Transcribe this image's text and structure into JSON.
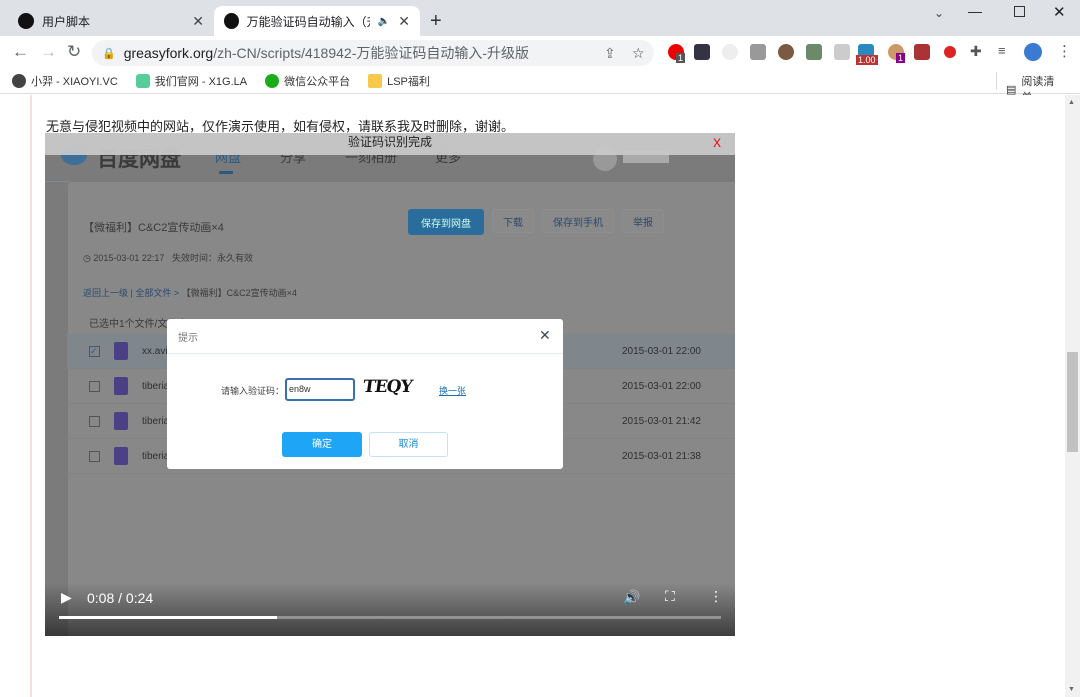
{
  "browser": {
    "tabs": [
      {
        "title": "用户脚本",
        "active": false
      },
      {
        "title": "万能验证码自动输入（升级版",
        "active": true
      }
    ],
    "url_host": "greasyfork.org",
    "url_path": "/zh-CN/scripts/418942-万能验证码自动输入-升级版",
    "bookmarks": [
      "小羿 - XIAOYI.VC",
      "我们官网 - X1G.LA",
      "微信公众平台",
      "LSP福利"
    ],
    "reading_list": "阅读清单",
    "ext_badges": [
      "1",
      "1.00",
      "1"
    ]
  },
  "page": {
    "notice": "无意与侵犯视频中的网站，仅作演示使用，如有侵权，请联系我及时删除，谢谢。"
  },
  "video": {
    "toast": "验证码识别完成",
    "toast_close": "X",
    "logo": "百度网盘",
    "nav": [
      "网盘",
      "分享",
      "一刻相册",
      "更多"
    ],
    "share_title": "【微福利】C&C2宣传动画×4",
    "buttons": [
      "保存到网盘",
      "下载",
      "保存到手机",
      "举报"
    ],
    "meta_date": "2015-03-01 22:17",
    "meta_expire": "失效时间：永久有效",
    "breadcrumb": [
      "返回上一级",
      "全部文件",
      "【微福利】C&C2宣传动画×4"
    ],
    "selected_text": "已选中1个文件/文件夹",
    "files": [
      {
        "name": "xx.avi",
        "date": "2015-03-01 22:00",
        "checked": true
      },
      {
        "name": "tiberian",
        "date": "2015-03-01 22:00",
        "checked": false
      },
      {
        "name": "tiberian",
        "date": "2015-03-01 21:42",
        "checked": false
      },
      {
        "name": "tiberian",
        "date": "2015-03-01 21:38",
        "checked": false
      }
    ],
    "dialog": {
      "title": "提示",
      "label": "请输入验证码：",
      "input": "en8w",
      "captcha": "TEQY",
      "refresh": "换一张",
      "ok": "确定",
      "cancel": "取消"
    },
    "time": "0:08 / 0:24",
    "progress": 0.33
  }
}
